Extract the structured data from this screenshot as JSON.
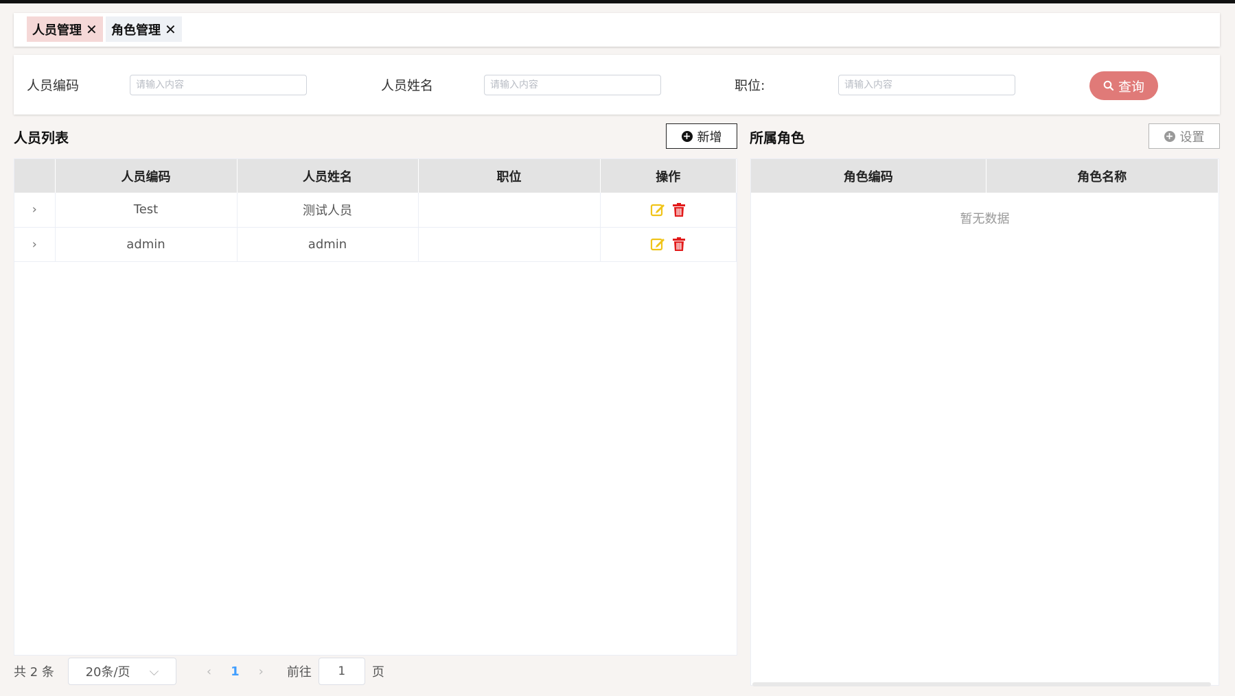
{
  "tabs": [
    {
      "label": "人员管理",
      "close": "✕"
    },
    {
      "label": "角色管理",
      "close": "✕"
    }
  ],
  "search": {
    "code_label": "人员编码",
    "name_label": "人员姓名",
    "position_label": "职位:",
    "placeholder": "请输入内容",
    "query_label": "查询"
  },
  "left": {
    "title": "人员列表",
    "add_label": "新增",
    "columns": [
      "人员编码",
      "人员姓名",
      "职位",
      "操作"
    ],
    "rows": [
      {
        "code": "Test",
        "name": "测试人员",
        "position": ""
      },
      {
        "code": "admin",
        "name": "admin",
        "position": ""
      }
    ]
  },
  "right": {
    "title": "所属角色",
    "set_label": "设置",
    "columns": [
      "角色编码",
      "角色名称"
    ],
    "empty": "暂无数据"
  },
  "pager": {
    "total": "共 2 条",
    "page_size": "20条/页",
    "current": "1",
    "goto_label": "前往",
    "goto_value": "1",
    "page_unit": "页"
  },
  "colors": {
    "query_button": "#e07a78",
    "active_tab": "#f5d8d7",
    "edit_icon": "#f0c419",
    "delete_icon": "#e21b1b",
    "current_page": "#409eff"
  }
}
